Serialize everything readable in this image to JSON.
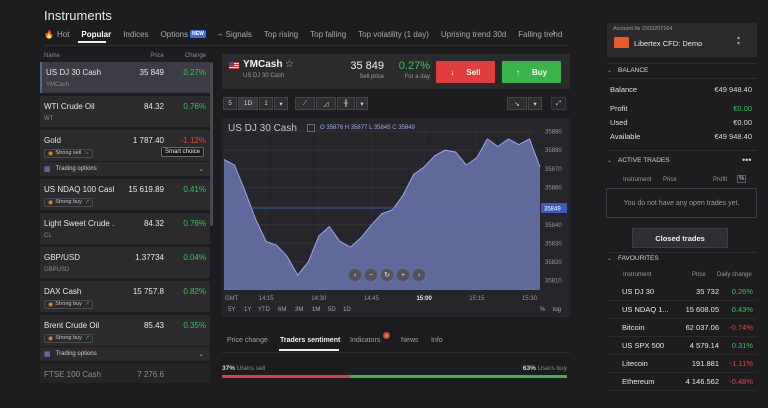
{
  "page": {
    "title": "Instruments"
  },
  "tabs": [
    {
      "label": "Hot",
      "icon": "fire-icon"
    },
    {
      "label": "Popular",
      "active": true
    },
    {
      "label": "Indices"
    },
    {
      "label": "Options",
      "badge": "NEW"
    },
    {
      "label": "Signals",
      "icon": "signal-icon"
    },
    {
      "label": "Top rising"
    },
    {
      "label": "Top falling"
    },
    {
      "label": "Top volatility (1 day)"
    },
    {
      "label": "Uprising trend 30d"
    },
    {
      "label": "Falling trend"
    }
  ],
  "list": {
    "headers": {
      "name": "Name",
      "price": "Price",
      "change": "Change"
    },
    "items": [
      {
        "name": "US DJ 30 Cash",
        "price": "35 849",
        "change": "0.27%",
        "trend": "up",
        "sub": "YMCash",
        "selected": true
      },
      {
        "name": "WTI Crude Oil",
        "price": "84.32",
        "change": "0.76%",
        "trend": "up",
        "sub": "WT"
      },
      {
        "name": "Gold",
        "price": "1 787.40",
        "change": "-1.12%",
        "trend": "down",
        "signal": "Strong sell",
        "smart": "Smart choice",
        "options": "Trading options"
      },
      {
        "name": "US NDAQ 100 Cash",
        "price": "15 619.89",
        "change": "0.41%",
        "trend": "up",
        "signal": "Strong buy"
      },
      {
        "name": "Light Sweet Crude ...",
        "price": "84.32",
        "change": "0.76%",
        "trend": "up",
        "sub": "CL"
      },
      {
        "name": "GBP/USD",
        "price": "1.37734",
        "change": "0.04%",
        "trend": "up",
        "sub": "GBPUSD"
      },
      {
        "name": "DAX Cash",
        "price": "15 757.8",
        "change": "0.82%",
        "trend": "up",
        "signal": "Strong buy"
      },
      {
        "name": "Brent Crude Oil",
        "price": "85.43",
        "change": "0.35%",
        "trend": "up",
        "signal": "Strong buy",
        "options": "Trading options"
      },
      {
        "name": "FTSE 100 Cash",
        "price": "7 276.6",
        "change": "",
        "trend": "up"
      }
    ]
  },
  "instrument": {
    "name": "YMCash",
    "subtitle": "US DJ 30 Cash",
    "price": "35 849",
    "price_label": "Sell price",
    "change": "0.27%",
    "change_label": "For a day",
    "sell_label": "Sell",
    "buy_label": "Buy"
  },
  "toolbar": {
    "interval": "5",
    "range": "1D",
    "count": "1"
  },
  "chart_data": {
    "type": "area",
    "title": "US DJ 30 Cash",
    "ohlc": {
      "O": "35876",
      "H": "35877",
      "L": "35845",
      "C": "35849"
    },
    "x_labels": [
      "14:15",
      "14:30",
      "14:45",
      "15:00",
      "15:15",
      "15:30"
    ],
    "x_axis_label": "GMT",
    "y_ticks": [
      35810,
      35820,
      35830,
      35840,
      35850,
      35860,
      35870,
      35880,
      35890
    ],
    "ylim": [
      35805,
      35893
    ],
    "current_value": "35849",
    "x": [
      "14:03",
      "14:06",
      "14:09",
      "14:12",
      "14:15",
      "14:18",
      "14:21",
      "14:24",
      "14:27",
      "14:30",
      "14:33",
      "14:36",
      "14:39",
      "14:42",
      "14:45",
      "14:48",
      "14:51",
      "14:54",
      "14:57",
      "15:00",
      "15:03",
      "15:06",
      "15:09",
      "15:12",
      "15:15",
      "15:18",
      "15:21",
      "15:24",
      "15:27",
      "15:30",
      "15:33"
    ],
    "values": [
      35875,
      35872,
      35858,
      35843,
      35831,
      35829,
      35823,
      35813,
      35820,
      35834,
      35839,
      35831,
      35828,
      35833,
      35840,
      35846,
      35848,
      35856,
      35867,
      35871,
      35877,
      35880,
      35879,
      35872,
      35876,
      35886,
      35882,
      35886,
      35883,
      35886,
      35871
    ],
    "periods": [
      "5Y",
      "1Y",
      "YTD",
      "6M",
      "3M",
      "1M",
      "5D",
      "1D"
    ],
    "log_label": "log",
    "pct_label": "%"
  },
  "bottom_tabs": [
    {
      "label": "Price change"
    },
    {
      "label": "Traders sentiment",
      "active": true
    },
    {
      "label": "Indicators",
      "badge": "9"
    },
    {
      "label": "News"
    },
    {
      "label": "Info"
    }
  ],
  "sentiment": {
    "sell_pct": "37%",
    "sell_label": "Users sell",
    "buy_pct": "63%",
    "buy_label": "Users buy",
    "sell_fraction": 0.37
  },
  "account": {
    "label": "Account № 2903207164",
    "name": "Libertex CFD: Demo"
  },
  "balance": {
    "title": "BALANCE",
    "rows": [
      {
        "k": "Balance",
        "v": "€49 948.40",
        "color": "normal"
      },
      {
        "k": "Profit",
        "v": "€0.00",
        "color": "green"
      },
      {
        "k": "Used",
        "v": "€0.00",
        "color": "normal"
      },
      {
        "k": "Available",
        "v": "€49 948.40",
        "color": "normal"
      }
    ]
  },
  "active_trades": {
    "title": "ACTIVE TRADES",
    "headers": {
      "instrument": "Instrument",
      "price": "Price",
      "profit": "Profit"
    },
    "empty": "You do not have any open trades yet.",
    "closed_button": "Closed trades"
  },
  "favourites": {
    "title": "FAVOURITES",
    "headers": {
      "instrument": "Instrument",
      "price": "Price",
      "change": "Daily change"
    },
    "rows": [
      {
        "name": "US DJ 30",
        "price": "35 732",
        "change": "0.26%",
        "trend": "up"
      },
      {
        "name": "US NDAQ 1...",
        "price": "15 608.05",
        "change": "0.43%",
        "trend": "up"
      },
      {
        "name": "Bitcoin",
        "price": "62 037.06",
        "change": "-0.74%",
        "trend": "down"
      },
      {
        "name": "US SPX 500",
        "price": "4 579.14",
        "change": "0.31%",
        "trend": "up"
      },
      {
        "name": "Litecoin",
        "price": "191.881",
        "change": "-1.11%",
        "trend": "down"
      },
      {
        "name": "Ethereum",
        "price": "4 146.562",
        "change": "-0.48%",
        "trend": "down"
      }
    ]
  }
}
